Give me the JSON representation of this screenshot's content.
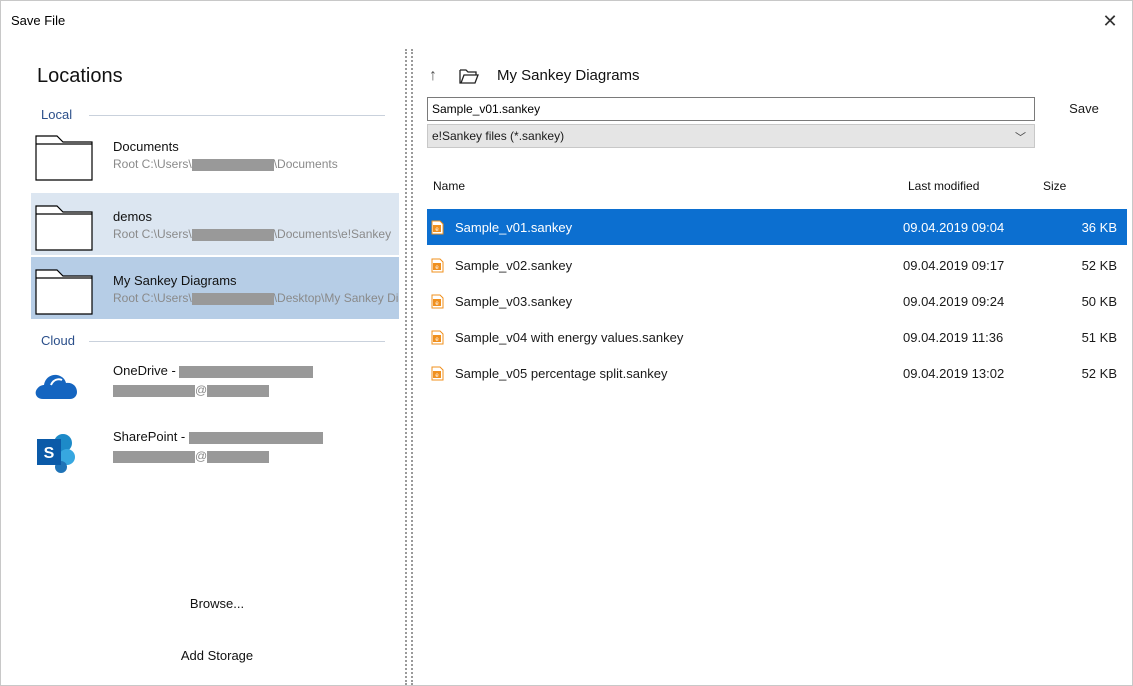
{
  "window": {
    "title": "Save File",
    "close_glyph": "✕"
  },
  "left": {
    "heading": "Locations",
    "groups": {
      "local": "Local",
      "cloud": "Cloud"
    },
    "local_items": [
      {
        "name": "Documents",
        "path_prefix": "Root C:\\Users\\",
        "path_suffix": "\\Documents"
      },
      {
        "name": "demos",
        "path_prefix": "Root C:\\Users\\",
        "path_suffix": "\\Documents\\e!Sankey"
      },
      {
        "name": "My Sankey Diagrams",
        "path_prefix": "Root C:\\Users\\",
        "path_suffix": "\\Desktop\\My Sankey Diagrams"
      }
    ],
    "cloud_items": [
      {
        "name": "OneDrive - ",
        "account_at": "@",
        "icon": "onedrive-cloud-icon"
      },
      {
        "name": "SharePoint - ",
        "account_at": "@",
        "icon": "sharepoint-icon"
      }
    ],
    "browse_label": "Browse...",
    "add_storage_label": "Add Storage"
  },
  "right": {
    "up_glyph": "↑",
    "current_folder": "My Sankey Diagrams",
    "filename_value": "Sample_v01.sankey",
    "save_label": "Save",
    "filetype_selected": "e!Sankey files (*.sankey)",
    "chevron_glyph": "﹀",
    "columns": {
      "name": "Name",
      "modified": "Last modified",
      "size": "Size"
    },
    "files": [
      {
        "name": "Sample_v01.sankey",
        "modified": "09.04.2019 09:04",
        "size": "36 KB",
        "selected": true
      },
      {
        "name": "Sample_v02.sankey",
        "modified": "09.04.2019 09:17",
        "size": "52 KB",
        "selected": false
      },
      {
        "name": "Sample_v03.sankey",
        "modified": "09.04.2019 09:24",
        "size": "50 KB",
        "selected": false
      },
      {
        "name": "Sample_v04 with energy values.sankey",
        "modified": "09.04.2019 11:36",
        "size": "51 KB",
        "selected": false
      },
      {
        "name": "Sample_v05 percentage split.sankey",
        "modified": "09.04.2019 13:02",
        "size": "52 KB",
        "selected": false
      }
    ]
  },
  "colors": {
    "selection": "#0c6fd0",
    "hover_item": "#dce6f1",
    "selected_item": "#b6cde6",
    "group_label": "#2b4f8a",
    "file_icon": "#f0901e"
  }
}
